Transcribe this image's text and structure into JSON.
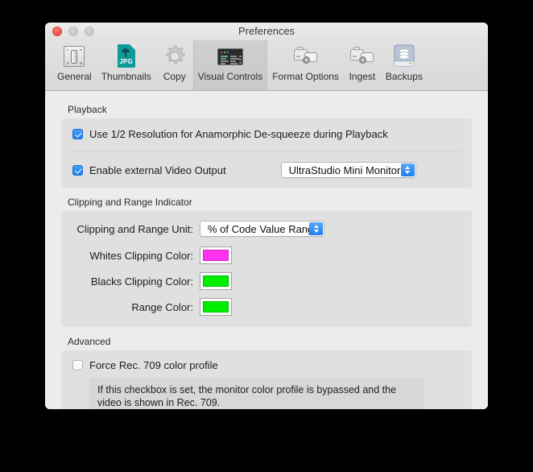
{
  "window": {
    "title": "Preferences",
    "traffic_lights": [
      "close",
      "minimize",
      "zoom"
    ]
  },
  "toolbar": {
    "items": [
      {
        "label": "General",
        "icon": "switch-plate-icon",
        "selected": false
      },
      {
        "label": "Thumbnails",
        "icon": "jpg-photo-icon",
        "selected": false
      },
      {
        "label": "Copy",
        "icon": "gear-icon",
        "selected": false
      },
      {
        "label": "Visual Controls",
        "icon": "control-panel-icon",
        "selected": true
      },
      {
        "label": "Format Options",
        "icon": "camera-transfer-icon",
        "selected": false
      },
      {
        "label": "Ingest",
        "icon": "camera-transfer-icon",
        "selected": false
      },
      {
        "label": "Backups",
        "icon": "hard-drive-icon",
        "selected": false
      }
    ]
  },
  "playback": {
    "title": "Playback",
    "half_res": {
      "label": "Use 1/2 Resolution for Anamorphic De-squeeze during Playback",
      "checked": true
    },
    "external_video": {
      "label": "Enable external Video Output",
      "checked": true,
      "device": "UltraStudio Mini Monitor"
    }
  },
  "clipping": {
    "title": "Clipping and Range Indicator",
    "unit_label": "Clipping and Range Unit:",
    "unit_value": "% of Code Value Range",
    "whites_label": "Whites Clipping Color:",
    "whites_color": "#FF33EE",
    "blacks_label": "Blacks Clipping Color:",
    "blacks_color": "#00EE00",
    "range_label": "Range Color:",
    "range_color": "#00EE00"
  },
  "advanced": {
    "title": "Advanced",
    "force_rec709": {
      "label": "Force Rec. 709 color profile",
      "checked": false
    },
    "help_text": "If this checkbox is set, the monitor color profile is bypassed and the video is shown in Rec. 709."
  }
}
